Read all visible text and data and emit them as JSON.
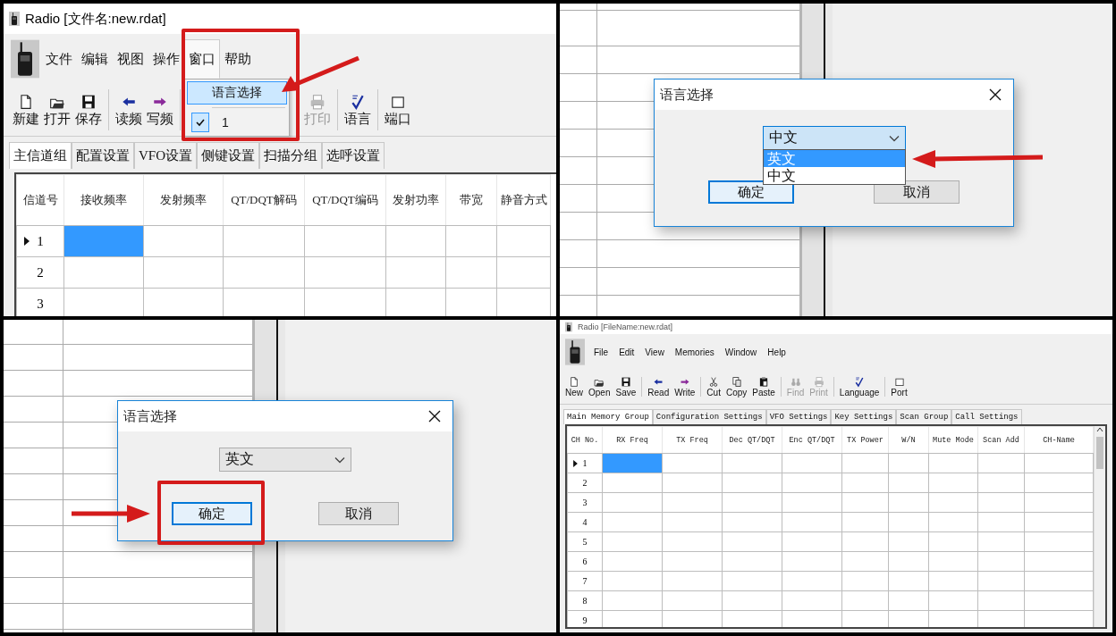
{
  "panels": [
    {
      "kind": "main_window",
      "title": "Radio [文件名:new.rdat]",
      "menus": [
        {
          "label": "文件",
          "open": false
        },
        {
          "label": "编辑",
          "open": false
        },
        {
          "label": "视图",
          "open": false
        },
        {
          "label": "操作",
          "open": false
        },
        {
          "label": "窗口",
          "open": true,
          "items": [
            {
              "kind": "command",
              "label": "语言选择",
              "highlighted": true,
              "callout": true
            },
            {
              "kind": "separator"
            },
            {
              "kind": "check",
              "label": "1",
              "checked": true
            }
          ]
        },
        {
          "label": "帮助",
          "open": false
        }
      ],
      "toolbar": [
        [
          {
            "kind": "new",
            "label": "新建",
            "disabled": false
          },
          {
            "kind": "open",
            "label": "打开",
            "disabled": false
          },
          {
            "kind": "save",
            "label": "保存",
            "disabled": false
          }
        ],
        [
          {
            "kind": "read",
            "label": "读频",
            "disabled": false
          },
          {
            "kind": "write",
            "label": "写频",
            "disabled": false
          }
        ],
        [
          {
            "kind": "print",
            "label": "打印",
            "disabled": true
          }
        ],
        [
          {
            "kind": "language",
            "label": "语言",
            "disabled": false
          }
        ],
        [
          {
            "kind": "port",
            "label": "端口",
            "disabled": false
          }
        ]
      ],
      "tabs": [
        {
          "label": "主信道组",
          "selected": true
        },
        {
          "label": "配置设置",
          "selected": false
        },
        {
          "label": "VFO设置",
          "selected": false
        },
        {
          "label": "侧键设置",
          "selected": false
        },
        {
          "label": "扫描分组",
          "selected": false
        },
        {
          "label": "选呼设置",
          "selected": false
        }
      ],
      "table": {
        "columns": [
          {
            "label": "信道号",
            "focused": false
          },
          {
            "label": "接收频率",
            "focused": true
          },
          {
            "label": "发射频率",
            "focused": false
          },
          {
            "label": "QT/DQT解码",
            "focused": false
          },
          {
            "label": "QT/DQT编码",
            "focused": false
          },
          {
            "label": "发射功率",
            "focused": false
          },
          {
            "label": "带宽",
            "focused": false
          },
          {
            "label": "静音方式",
            "focused": false
          }
        ],
        "rows": [
          {
            "label": "1",
            "current": true
          },
          {
            "label": "2",
            "current": false
          },
          {
            "label": "3",
            "current": false
          }
        ]
      }
    },
    {
      "kind": "dialog_over_window",
      "dialog": {
        "title": "语言选择",
        "combo": {
          "value": "中文",
          "open": true,
          "options": [
            {
              "label": "英文",
              "highlighted": true,
              "callout": true
            },
            {
              "label": "中文",
              "highlighted": false
            }
          ]
        },
        "buttons": [
          {
            "label": "确定",
            "focused": true
          },
          {
            "label": "取消",
            "focused": false
          }
        ]
      }
    },
    {
      "kind": "dialog_over_window",
      "dialog": {
        "title": "语言选择",
        "combo": {
          "value": "英文",
          "open": false
        },
        "buttons": [
          {
            "label": "确定",
            "focused": true,
            "callout": true
          },
          {
            "label": "取消",
            "focused": false
          }
        ]
      }
    },
    {
      "kind": "main_window",
      "title": "Radio [FileName:new.rdat]",
      "menus": [
        {
          "label": "File",
          "open": false
        },
        {
          "label": "Edit",
          "open": false
        },
        {
          "label": "View",
          "open": false
        },
        {
          "label": "Memories",
          "open": false
        },
        {
          "label": "Window",
          "open": false
        },
        {
          "label": "Help",
          "open": false
        }
      ],
      "toolbar": [
        [
          {
            "kind": "new",
            "label": "New",
            "disabled": false
          },
          {
            "kind": "open",
            "label": "Open",
            "disabled": false
          },
          {
            "kind": "save",
            "label": "Save",
            "disabled": false
          }
        ],
        [
          {
            "kind": "read",
            "label": "Read",
            "disabled": false
          },
          {
            "kind": "write",
            "label": "Write",
            "disabled": false
          }
        ],
        [
          {
            "kind": "cut",
            "label": "Cut",
            "disabled": false
          },
          {
            "kind": "copy",
            "label": "Copy",
            "disabled": false
          },
          {
            "kind": "paste",
            "label": "Paste",
            "disabled": false
          }
        ],
        [
          {
            "kind": "find",
            "label": "Find",
            "disabled": true
          },
          {
            "kind": "print",
            "label": "Print",
            "disabled": true
          }
        ],
        [
          {
            "kind": "language",
            "label": "Language",
            "disabled": false
          }
        ],
        [
          {
            "kind": "port",
            "label": "Port",
            "disabled": false
          }
        ]
      ],
      "tabs": [
        {
          "label": "Main Memory Group",
          "selected": true
        },
        {
          "label": "Configuration Settings",
          "selected": false
        },
        {
          "label": "VFO Settings",
          "selected": false
        },
        {
          "label": "Key Settings",
          "selected": false
        },
        {
          "label": "Scan Group",
          "selected": false
        },
        {
          "label": "Call Settings",
          "selected": false
        }
      ],
      "table": {
        "columns": [
          {
            "label": "CH No.",
            "focused": false
          },
          {
            "label": "RX Freq",
            "focused": true
          },
          {
            "label": "TX Freq",
            "focused": false
          },
          {
            "label": "Dec QT/DQT",
            "focused": false
          },
          {
            "label": "Enc QT/DQT",
            "focused": false
          },
          {
            "label": "TX Power",
            "focused": false
          },
          {
            "label": "W/N",
            "focused": false
          },
          {
            "label": "Mute Mode",
            "focused": false
          },
          {
            "label": "Scan Add",
            "focused": false
          },
          {
            "label": "CH-Name",
            "focused": false
          }
        ],
        "rows": [
          {
            "label": "1",
            "current": true
          },
          {
            "label": "2",
            "current": false
          },
          {
            "label": "3",
            "current": false
          },
          {
            "label": "4",
            "current": false
          },
          {
            "label": "5",
            "current": false
          },
          {
            "label": "6",
            "current": false
          },
          {
            "label": "7",
            "current": false
          },
          {
            "label": "8",
            "current": false
          },
          {
            "label": "9",
            "current": false
          }
        ]
      }
    }
  ]
}
